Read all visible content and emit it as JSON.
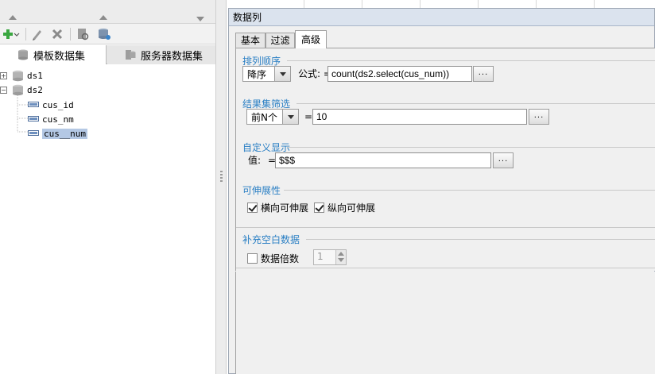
{
  "left_panel": {
    "toolbar": {
      "add_icon": "green-plus-icon",
      "edit_icon": "pencil-icon",
      "delete_icon": "x-icon",
      "preview_icon": "document-icon",
      "connect_icon": "database-link-icon"
    },
    "tabs": [
      {
        "label": "模板数据集",
        "icon": "database-icon"
      },
      {
        "label": "服务器数据集",
        "icon": "server-db-icon"
      }
    ],
    "tree": [
      {
        "label": "ds1",
        "expander": "+"
      },
      {
        "label": "ds2",
        "expander": "−",
        "children": [
          {
            "label": "cus_id"
          },
          {
            "label": "cus_nm"
          },
          {
            "label": "cus__num"
          }
        ]
      }
    ]
  },
  "dialog": {
    "title": "数据列",
    "tabs": [
      {
        "label": "基本"
      },
      {
        "label": "过滤"
      },
      {
        "label": "高级"
      }
    ],
    "sort": {
      "title": "排列顺序",
      "order_value": "降序",
      "formula_label": "公式: =",
      "formula_value": "count(ds2.select(cus_num))",
      "more_label": "..."
    },
    "result_filter": {
      "title": "结果集筛选",
      "mode_value": "前N个",
      "eq_label": "=",
      "value": "10",
      "more_label": "..."
    },
    "custom_display": {
      "title": "自定义显示",
      "value_label": "值:",
      "eq_label": "=",
      "value": "$$$",
      "more_label": "..."
    },
    "expand": {
      "title": "可伸展性",
      "horizontal_label": "横向可伸展",
      "horizontal_checked": true,
      "vertical_label": "纵向可伸展",
      "vertical_checked": true
    },
    "fill_blank": {
      "title": "补充空白数据",
      "multiple_label": "数据倍数",
      "multiple_checked": false,
      "multiple_value": "1"
    }
  },
  "colors": {
    "group_title": "#2a7fc4",
    "selection": "#b4c8e4",
    "title_bar": "#dbe3ee"
  }
}
